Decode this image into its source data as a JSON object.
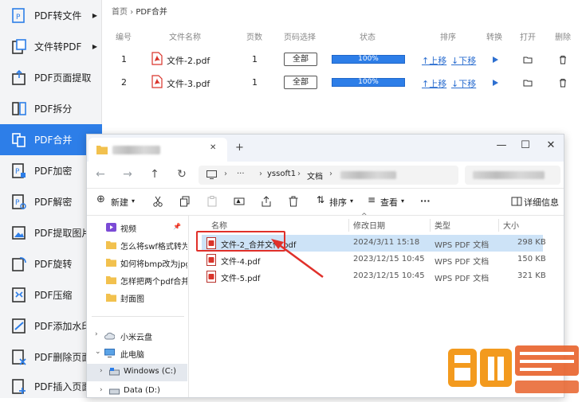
{
  "sidebar": {
    "items": [
      {
        "label": "PDF转文件",
        "icon": "pdf-to-file-icon",
        "arrow": "▶",
        "active": false
      },
      {
        "label": "文件转PDF",
        "icon": "file-to-pdf-icon",
        "arrow": "▶",
        "active": false
      },
      {
        "label": "PDF页面提取",
        "icon": "page-extract-icon",
        "arrow": "",
        "active": false
      },
      {
        "label": "PDF拆分",
        "icon": "split-icon",
        "arrow": "",
        "active": false
      },
      {
        "label": "PDF合并",
        "icon": "merge-icon",
        "arrow": "",
        "active": true
      },
      {
        "label": "PDF加密",
        "icon": "encrypt-icon",
        "arrow": "",
        "active": false
      },
      {
        "label": "PDF解密",
        "icon": "decrypt-icon",
        "arrow": "",
        "active": false
      },
      {
        "label": "PDF提取图片",
        "icon": "extract-image-icon",
        "arrow": "",
        "active": false
      },
      {
        "label": "PDF旋转",
        "icon": "rotate-icon",
        "arrow": "",
        "active": false
      },
      {
        "label": "PDF压缩",
        "icon": "compress-icon",
        "arrow": "",
        "active": false
      },
      {
        "label": "PDF添加水印",
        "icon": "watermark-icon",
        "arrow": "",
        "active": false
      },
      {
        "label": "PDF删除页面",
        "icon": "delete-page-icon",
        "arrow": "",
        "active": false
      },
      {
        "label": "PDF插入页面",
        "icon": "insert-page-icon",
        "arrow": "",
        "active": false
      }
    ]
  },
  "breadcrumb": {
    "home": "首页",
    "sep": "›",
    "current": "PDF合并"
  },
  "table": {
    "headers": [
      "编号",
      "文件名称",
      "页数",
      "页码选择",
      "状态",
      "排序",
      "转换",
      "打开",
      "删除"
    ],
    "rows": [
      {
        "num": "1",
        "name": "文件-2.pdf",
        "pages": "1",
        "page_select": "全部",
        "status": "100%",
        "up": "↑上移",
        "down": "↓下移"
      },
      {
        "num": "2",
        "name": "文件-3.pdf",
        "pages": "1",
        "page_select": "全部",
        "status": "100%",
        "up": "↑上移",
        "down": "↓下移"
      }
    ]
  },
  "explorer": {
    "close_tab": "✕",
    "new_tab": "+",
    "window_buttons": {
      "minimize": "—",
      "maximize": "☐",
      "close": "✕"
    },
    "address": {
      "crumb_sep": "›",
      "ellipsis": "···",
      "part1": "yssoft1",
      "part2": "文档"
    },
    "toolbar": {
      "new": "新建",
      "sort": "排序",
      "view": "查看",
      "more": "···",
      "details": "详细信息"
    },
    "nav": {
      "items": [
        {
          "label": "视频",
          "pinned": "📌"
        },
        {
          "label": "怎么将swf格式转为mp"
        },
        {
          "label": "如何将bmp改为jpg格"
        },
        {
          "label": "怎样把两个pdf合并成"
        },
        {
          "label": "封面图"
        }
      ],
      "cloud": "小米云盘",
      "pc": "此电脑",
      "drive_c": "Windows (C:)",
      "drive_d": "Data (D:)"
    },
    "columns": {
      "name": "名称",
      "modified": "修改日期",
      "type": "类型",
      "size": "大小"
    },
    "files": [
      {
        "name": "文件-2_合并文件.pdf",
        "modified": "2024/3/11 15:18",
        "type": "WPS PDF 文档",
        "size": "298 KB"
      },
      {
        "name": "文件-4.pdf",
        "modified": "2023/12/15 10:45",
        "type": "WPS PDF 文档",
        "size": "150 KB"
      },
      {
        "name": "文件-5.pdf",
        "modified": "2023/12/15 10:45",
        "type": "WPS PDF 文档",
        "size": "321 KB"
      }
    ]
  },
  "colors": {
    "accent": "#2d7ee8",
    "highlight": "#e0302a",
    "pdf_red": "#d9342b"
  }
}
